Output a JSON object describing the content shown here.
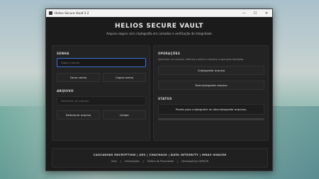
{
  "window": {
    "title": "Helios Secure Vault 2.2",
    "controls": [
      "—",
      "☐",
      "✕"
    ]
  },
  "header": {
    "title": "HELIOS SECURE VAULT",
    "subtitle": "Arquivo seguro com criptografia em camadas e verificação de integridade"
  },
  "senha": {
    "title": "SENHA",
    "placeholder": "Digite a senha",
    "generate_label": "Gerar senha",
    "copy_label": "Copiar senha"
  },
  "arquivo": {
    "title": "ARQUIVO",
    "placeholder": "Selecione um arquivo",
    "select_label": "Selecionar arquivo",
    "clear_label": "Limpar"
  },
  "operacoes": {
    "title": "OPERAÇÕES",
    "hint": "Selecione um arquivo, informe a senha e escolha a operação desejada.",
    "encrypt_label": "Criptografar arquivo",
    "decrypt_label": "Descriptografar arquivo"
  },
  "status": {
    "title": "STATUS",
    "message": "Pronto para criptografar ou descriptografar arquivos."
  },
  "footer": {
    "tech": "CASCADING ENCRYPTION | AES | CHACHA20 | DATA INTEGRITY | HMAC-SHA256",
    "links": [
      "Doar",
      "Informações",
      "Política de Privacidade",
      "Developed by HARSUR"
    ],
    "separator": "|"
  }
}
